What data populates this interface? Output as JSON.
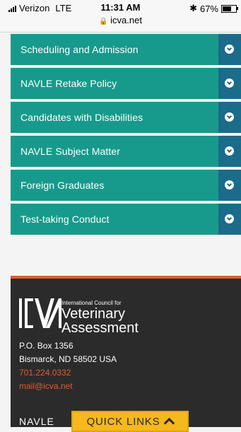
{
  "status": {
    "carrier": "Verizon",
    "network": "LTE",
    "time": "11:31 AM",
    "url": "icva.net",
    "battery": "67%",
    "battery_level": 0.67
  },
  "accordion": [
    {
      "label": "Scheduling and Admission"
    },
    {
      "label": "NAVLE Retake Policy"
    },
    {
      "label": "Candidates with Disabilities"
    },
    {
      "label": "NAVLE Subject Matter"
    },
    {
      "label": "Foreign Graduates"
    },
    {
      "label": "Test-taking Conduct"
    }
  ],
  "footer": {
    "logo_small": "International Council for",
    "logo_line1": "Veterinary",
    "logo_line2": "Assessment",
    "address1": "P.O. Box 1356",
    "address2": "Bismarck, ND 58502 USA",
    "phone": "701.224.0332",
    "email": "mail@icva.net",
    "heading": "NAVLE"
  },
  "quick_links": {
    "label": "QUICK LINKS"
  },
  "colors": {
    "accordion_bg": "#179a8b",
    "toggle_bg": "#1b6b8a",
    "footer_bg": "#2b2b2b",
    "accent": "#e35b2c",
    "quick_links_bg": "#f5b81d"
  }
}
